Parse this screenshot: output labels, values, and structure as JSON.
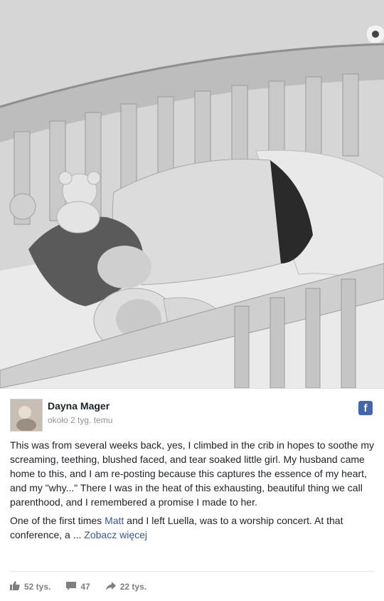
{
  "photo": {
    "alt_icon": "photo-crib"
  },
  "post": {
    "author": "Dayna Mager",
    "time": "około 2 tyg. temu",
    "paragraph1": "This was from several weeks back, yes, I climbed in the crib in hopes to soothe my screaming, teething, blushed faced, and tear soaked little girl. My husband came home to this, and I am re-posting because this captures the essence of my heart, and my \"why...\" There I was in the heat of this exhausting, beautiful thing we call parenthood, and I remembered a promise I made to her.",
    "p2_before": "One of the first times ",
    "p2_link": "Matt",
    "p2_after": " and I left Luella, was to a worship concert. At that conference, a ... ",
    "see_more": "Zobacz więcej",
    "fb_letter": "f"
  },
  "actions": {
    "likes": "52 tys.",
    "comments": "47",
    "shares": "22 tys."
  },
  "colors": {
    "facebook_blue": "#4267b2",
    "link_blue": "#365899",
    "meta_grey": "#90949c"
  }
}
